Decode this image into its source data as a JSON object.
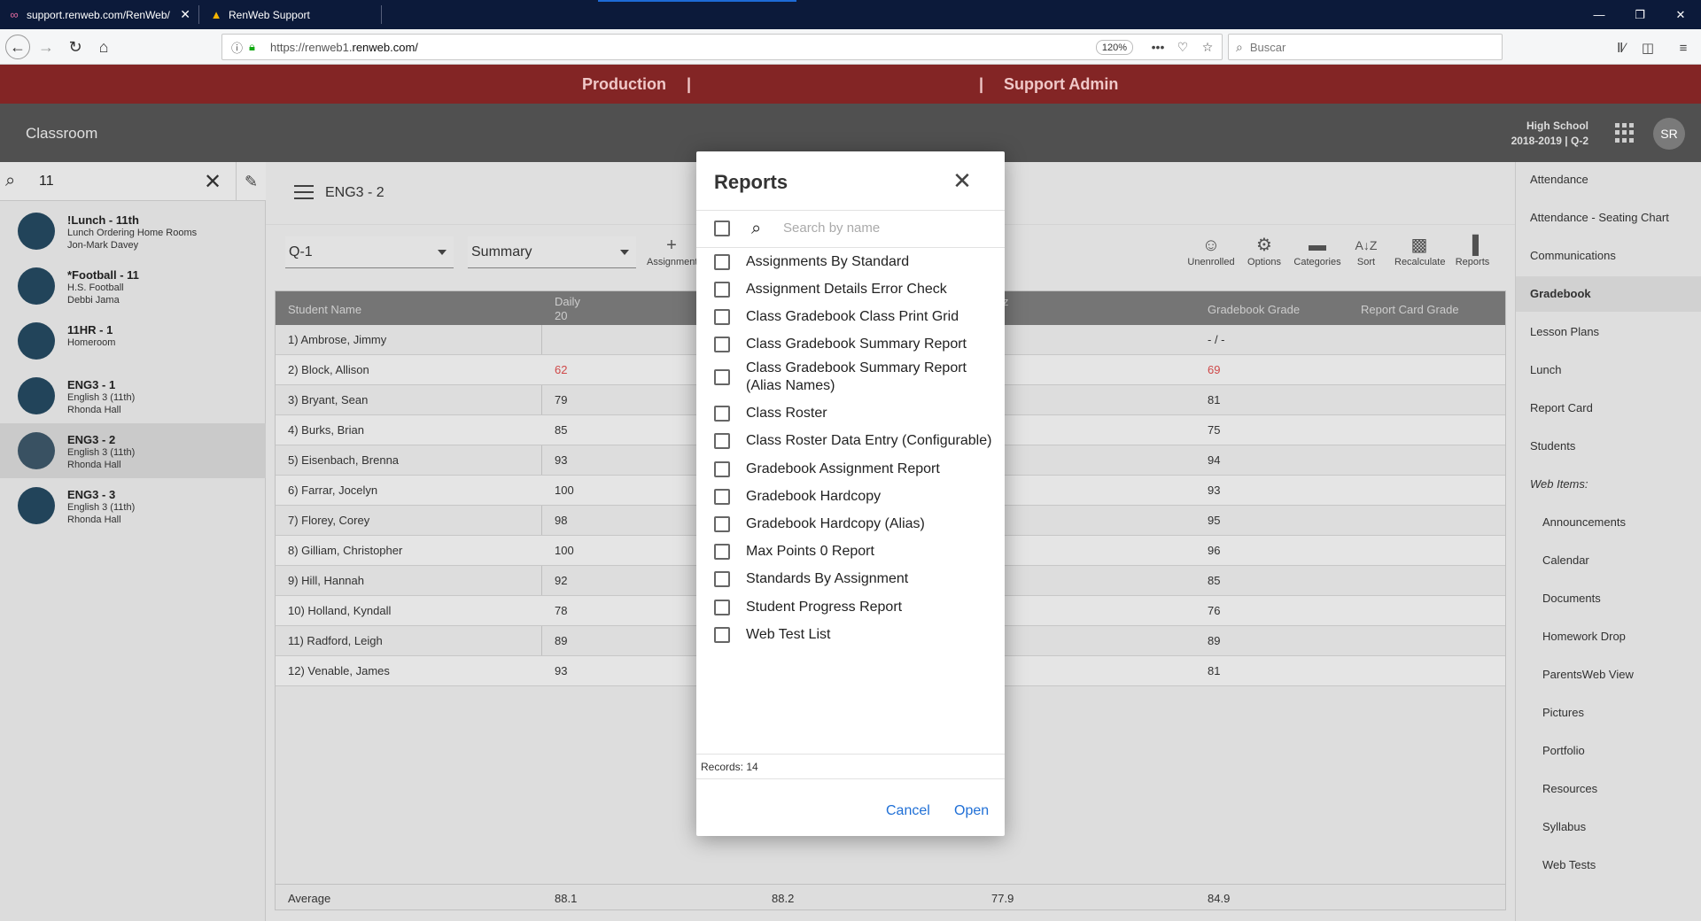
{
  "browser": {
    "tabs": [
      {
        "label": "support.renweb.com/RenWeb/",
        "icon": "renweb-link-icon"
      },
      {
        "label": "RenWeb Support",
        "icon": "renweb-logo-icon"
      }
    ],
    "url_prefix": "https://renweb1.",
    "url_host": "renweb.com/",
    "zoom": "120%",
    "search_placeholder": "Buscar"
  },
  "app": {
    "production_label": "Production",
    "separator": "|",
    "support_admin_label": "Support Admin",
    "section_title": "Classroom",
    "school_line1": "High School",
    "school_line2": "2018-2019 | Q-2",
    "user_initials": "SR"
  },
  "left": {
    "search_value": "11",
    "classes": [
      {
        "name": "!Lunch - 11th",
        "line1": "Lunch Ordering Home Rooms",
        "line2": "Jon-Mark Davey"
      },
      {
        "name": "*Football - 11",
        "line1": "H.S. Football",
        "line2": "Debbi Jama"
      },
      {
        "name": "11HR - 1",
        "line1": "Homeroom",
        "line2": ""
      },
      {
        "name": "ENG3 - 1",
        "line1": "English 3 (11th)",
        "line2": "Rhonda Hall"
      },
      {
        "name": "ENG3 - 2",
        "line1": "English 3 (11th)",
        "line2": "Rhonda Hall"
      },
      {
        "name": "ENG3 - 3",
        "line1": "English 3 (11th)",
        "line2": "Rhonda Hall"
      }
    ]
  },
  "main": {
    "class_title": "ENG3 - 2",
    "term_select": "Q-1",
    "view_select": "Summary",
    "toolbar": {
      "assignment": "Assignment",
      "unenrolled": "Unenrolled",
      "options": "Options",
      "categories": "Categories",
      "sort": "Sort",
      "recalculate": "Recalculate",
      "reports": "Reports"
    },
    "headers": {
      "student": "Student Name",
      "daily": "Daily",
      "daily_sub": "20",
      "quiz": "iz",
      "gradebook": "Gradebook Grade",
      "report_card": "Report Card Grade"
    },
    "rows": [
      {
        "name": "1) Ambrose, Jimmy",
        "daily": "",
        "grade": "- / -"
      },
      {
        "name": "2) Block, Allison",
        "daily": "62",
        "grade": "69"
      },
      {
        "name": "3) Bryant, Sean",
        "daily": "79",
        "grade": "81"
      },
      {
        "name": "4) Burks, Brian",
        "daily": "85",
        "grade": "75"
      },
      {
        "name": "5) Eisenbach, Brenna",
        "daily": "93",
        "grade": "94"
      },
      {
        "name": "6) Farrar, Jocelyn",
        "daily": "100",
        "grade": "93"
      },
      {
        "name": "7) Florey, Corey",
        "daily": "98",
        "grade": "95"
      },
      {
        "name": "8) Gilliam, Christopher",
        "daily": "100",
        "grade": "96"
      },
      {
        "name": "9) Hill, Hannah",
        "daily": "92",
        "grade": "85"
      },
      {
        "name": "10) Holland, Kyndall",
        "daily": "78",
        "grade": "76"
      },
      {
        "name": "11) Radford, Leigh",
        "daily": "89",
        "grade": "89"
      },
      {
        "name": "12) Venable, James",
        "daily": "93",
        "grade": "81"
      }
    ],
    "average": {
      "label": "Average",
      "v1": "88.1",
      "v2": "88.2",
      "v3": "77.9",
      "v4": "84.9"
    }
  },
  "right": {
    "items": [
      "Attendance",
      "Attendance - Seating Chart",
      "Communications",
      "Gradebook",
      "Lesson Plans",
      "Lunch",
      "Report Card",
      "Students",
      "Web Items:"
    ],
    "web_items": [
      "Announcements",
      "Calendar",
      "Documents",
      "Homework Drop",
      "ParentsWeb View",
      "Pictures",
      "Portfolio",
      "Resources",
      "Syllabus",
      "Web Tests"
    ]
  },
  "modal": {
    "title": "Reports",
    "search_placeholder": "Search by name",
    "reports": [
      "Assignments By Standard",
      "Assignment Details Error Check",
      "Class Gradebook Class Print Grid",
      "Class Gradebook Summary Report",
      "Class Gradebook Summary Report (Alias Names)",
      "Class Roster",
      "Class Roster Data Entry (Configurable)",
      "Gradebook Assignment Report",
      "Gradebook Hardcopy",
      "Gradebook Hardcopy (Alias)",
      "Max Points 0 Report",
      "Standards By Assignment",
      "Student Progress Report",
      "Web Test List"
    ],
    "records": "Records: 14",
    "cancel": "Cancel",
    "open": "Open"
  },
  "colors": {
    "brand_red": "#832525",
    "header_gray": "#505050",
    "link_blue": "#1f6fd6",
    "low_grade_red": "#d84c4c"
  }
}
